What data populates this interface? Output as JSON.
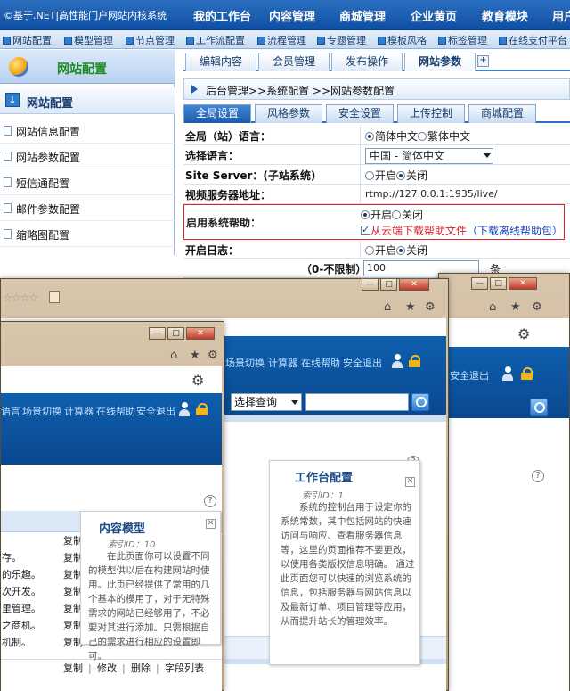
{
  "topbar": {
    "brand": "©基于.NET|高性能门户网站内核系统",
    "menu": [
      "我的工作台",
      "内容管理",
      "商城管理",
      "企业黄页",
      "教育模块",
      "用户"
    ]
  },
  "subnav": [
    "网站配置",
    "模型管理",
    "节点管理",
    "工作流配置",
    "流程管理",
    "专题管理",
    "模板风格",
    "标签管理",
    "在线支付平台"
  ],
  "sidebar": {
    "title": "网站配置",
    "section": "网站配置",
    "items": [
      "网站信息配置",
      "网站参数配置",
      "短信通配置",
      "邮件参数配置",
      "缩略图配置"
    ]
  },
  "tabs": [
    "编辑内容",
    "会员管理",
    "发布操作",
    "网站参数"
  ],
  "tab_add": "+",
  "breadcrumb": "后台管理>>系统配置 >>网站参数配置",
  "subtabs": [
    "全局设置",
    "风格参数",
    "安全设置",
    "上传控制",
    "商城配置"
  ],
  "form": {
    "lang_label": "全局（站）语言：",
    "lang_opt1": "简体中文",
    "lang_opt2": "繁体中文",
    "select_label": "选择语言：",
    "select_value": "中国 - 简体中文",
    "server_label": "Site Server：(子站系统)",
    "on": "开启",
    "off": "关闭",
    "video_label": "视频服务器地址：",
    "video_value": "rtmp://127.0.0.1:1935/live/",
    "help_label": "启用系统帮助：",
    "help_cloud": "从云端下载帮助文件",
    "help_offline": "（下载离线帮助包）",
    "log_label": "开启日志：",
    "next_label_partial": "（0-不限制）",
    "log_input": "100",
    "unit": "条"
  },
  "windows": {
    "toolbar_links_a": [
      "场景切换",
      "计算器",
      "在线帮助",
      "安全退出"
    ],
    "toolbar_links_b": [
      "安全退出"
    ],
    "toolbar_links_c": [
      "语言",
      "场景切换",
      "计算器",
      "在线帮助",
      "安全退出"
    ],
    "search_select": "选择查询",
    "card_workbench": {
      "title": "工作台配置",
      "id": "索引ID：1",
      "text": "系统的控制台用于设定你的系统常数，其中包括网站的快速访问与响应、查看服务器信息等，这里的页面推荐不要更改，以使用各类版权信息明确。 通过此页面您可以快速的浏览系统的信息，包括服务器与网站信息以及最新订单、项目管理等应用，从而提升站长的管理效率。"
    },
    "card_model": {
      "title": "内容模型",
      "id": "索引ID：10",
      "text": "在此页面你可以设置不同的模型供以后在构建网站时使用。此页已经提供了常用的几个基本的模用了，对于无特殊需求的网站已经够用了，不必要对其进行添加。只需根据自己的需求进行相应的设置即可。"
    },
    "row_action": "复制",
    "row_snippets": [
      "存。",
      "的乐趣。",
      "次开发。",
      "里管理。",
      "之商机。",
      "机制。"
    ],
    "bottom_actions": [
      "复制",
      "修改",
      "删除",
      "字段列表"
    ]
  }
}
